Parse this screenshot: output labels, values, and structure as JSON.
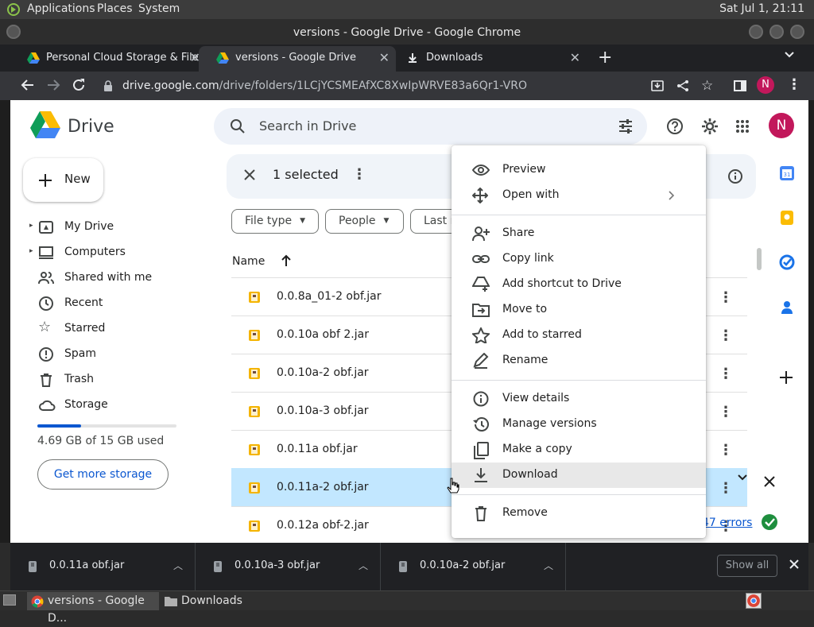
{
  "os": {
    "menu": [
      "Applications",
      "Places",
      "System"
    ],
    "clock": "Sat Jul 1, 21:11"
  },
  "window": {
    "title": "versions - Google Drive - Google Chrome"
  },
  "tabs": [
    {
      "label": "Personal Cloud Storage & File",
      "active": false
    },
    {
      "label": "versions - Google Drive",
      "active": true
    },
    {
      "label": "Downloads",
      "active": false
    }
  ],
  "address": {
    "domain": "drive.google.com",
    "path": "/drive/folders/1LCjYCSMEAfXC8XwIpWRVE83a6Qr1-VRO"
  },
  "profile_initial": "N",
  "drive": {
    "title": "Drive",
    "search_placeholder": "Search in Drive",
    "new_label": "New",
    "nav": [
      {
        "label": "My Drive",
        "icon": "my-drive-icon"
      },
      {
        "label": "Computers",
        "icon": "computer-icon"
      },
      {
        "label": "Shared with me",
        "icon": "people-icon"
      },
      {
        "label": "Recent",
        "icon": "clock-icon"
      },
      {
        "label": "Starred",
        "icon": "star-icon"
      },
      {
        "label": "Spam",
        "icon": "spam-icon"
      },
      {
        "label": "Trash",
        "icon": "trash-icon"
      },
      {
        "label": "Storage",
        "icon": "cloud-icon"
      }
    ],
    "storage_text": "4.69 GB of 15 GB used",
    "storage_fraction": 0.313,
    "get_storage_label": "Get more storage",
    "selection": {
      "count_label": "1 selected"
    },
    "filters": [
      "File type",
      "People",
      "Last m"
    ],
    "column_name": "Name",
    "files": [
      {
        "name": "0.0.8a_01-2 obf.jar",
        "selected": false
      },
      {
        "name": "0.0.10a obf 2.jar",
        "selected": false
      },
      {
        "name": "0.0.10a-2 obf.jar",
        "selected": false
      },
      {
        "name": "0.0.10a-3 obf.jar",
        "selected": false
      },
      {
        "name": "0.0.11a obf.jar",
        "selected": false
      },
      {
        "name": "0.0.11a-2 obf.jar",
        "selected": true
      },
      {
        "name": "0.0.12a obf-2.jar",
        "selected": false
      }
    ],
    "status_link": "47 errors"
  },
  "context_menu": {
    "items": [
      {
        "label": "Preview",
        "icon": "eye-icon"
      },
      {
        "label": "Open with",
        "icon": "move-arrows-icon",
        "submenu": true
      },
      {
        "label": "Share",
        "icon": "person-add-icon"
      },
      {
        "label": "Copy link",
        "icon": "link-icon"
      },
      {
        "label": "Add shortcut to Drive",
        "icon": "add-shortcut-icon"
      },
      {
        "label": "Move to",
        "icon": "folder-move-icon"
      },
      {
        "label": "Add to starred",
        "icon": "star-icon"
      },
      {
        "label": "Rename",
        "icon": "pencil-icon"
      },
      {
        "label": "View details",
        "icon": "info-icon"
      },
      {
        "label": "Manage versions",
        "icon": "history-icon"
      },
      {
        "label": "Make a copy",
        "icon": "copy-icon"
      },
      {
        "label": "Download",
        "icon": "download-icon",
        "highlighted": true
      },
      {
        "label": "Remove",
        "icon": "trash-icon"
      }
    ]
  },
  "downloads_shelf": {
    "items": [
      "0.0.11a obf.jar",
      "0.0.10a-3 obf.jar",
      "0.0.10a-2 obf.jar"
    ],
    "show_all": "Show all"
  },
  "taskbar": {
    "items": [
      "versions - Google D...",
      "Downloads"
    ]
  },
  "colors": {
    "accent": "#0b57d0",
    "selected_row": "#c2e7ff",
    "avatar": "#c2185b"
  }
}
